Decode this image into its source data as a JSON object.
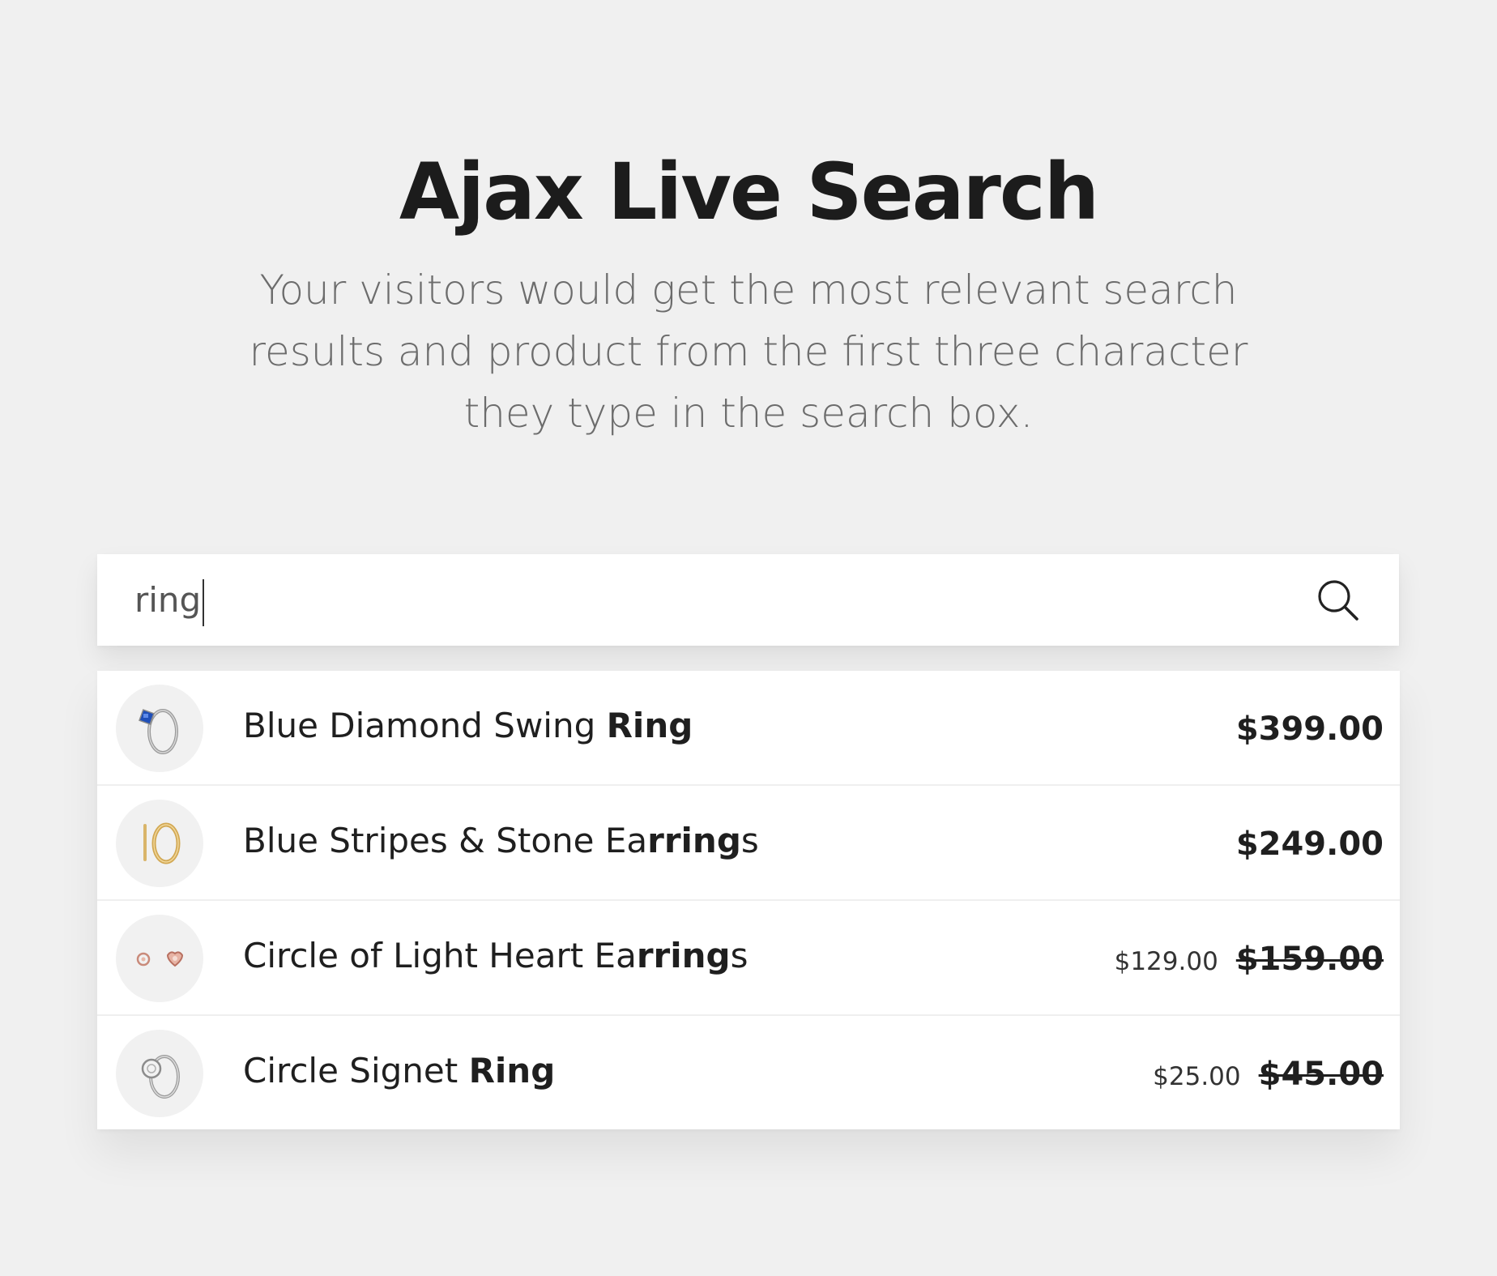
{
  "hero": {
    "title": "Ajax Live Search",
    "description": "Your visitors would get the most relevant search results and product from the first three character they type in the search box."
  },
  "search": {
    "query": "ring",
    "icon": "search-icon"
  },
  "results": [
    {
      "name_before": "Blue Diamond Swing ",
      "name_match": "Ring",
      "name_after": "",
      "price": "$399.00",
      "sale_price": "",
      "old_price": "",
      "thumb": "blue-diamond-ring"
    },
    {
      "name_before": "Blue Stripes & Stone Ea",
      "name_match": "rring",
      "name_after": "s",
      "price": "$249.00",
      "sale_price": "",
      "old_price": "",
      "thumb": "gold-hoop-earrings"
    },
    {
      "name_before": "Circle of Light Heart Ea",
      "name_match": "rring",
      "name_after": "s",
      "price": "",
      "sale_price": "$129.00",
      "old_price": "$159.00",
      "thumb": "rose-gold-heart-earrings"
    },
    {
      "name_before": "Circle Signet ",
      "name_match": "Ring",
      "name_after": "",
      "price": "",
      "sale_price": "$25.00",
      "old_price": "$45.00",
      "thumb": "silver-signet-ring"
    }
  ],
  "colors": {
    "background": "#f0f0f0",
    "panel": "#ffffff",
    "text": "#1f1f1f",
    "muted_text": "#6c6c6c"
  }
}
